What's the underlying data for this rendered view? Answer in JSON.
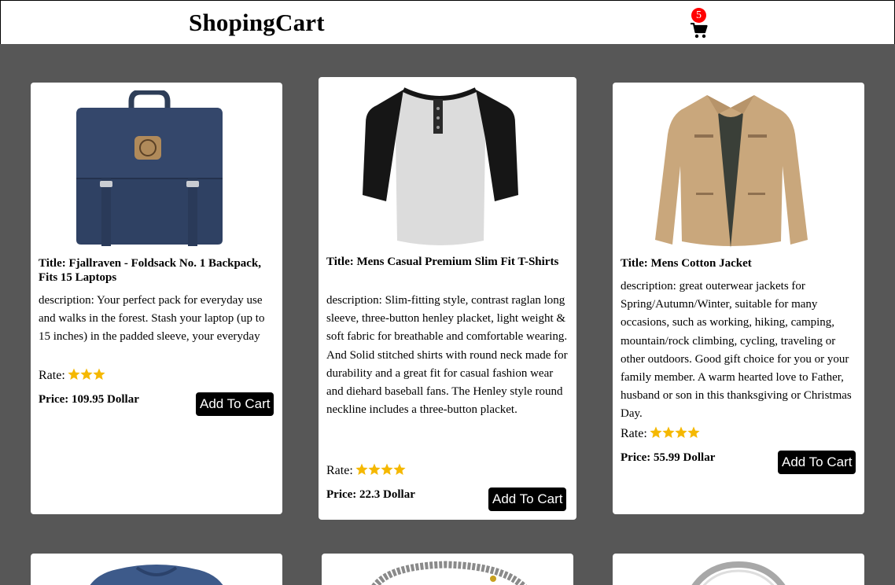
{
  "header": {
    "logo": "ShopingCart",
    "cart_count": "5"
  },
  "rate_label": "Rate:",
  "button_label": "Add To Cart",
  "products": [
    {
      "title": "Title: Fjallraven - Foldsack No. 1 Backpack, Fits 15 Laptops",
      "description": "description: Your perfect pack for everyday use and walks in the forest. Stash your laptop (up to 15 inches) in the padded sleeve, your everyday",
      "rating": 3,
      "price": "Price: 109.95 Dollar"
    },
    {
      "title": "Title: Mens Casual Premium Slim Fit T-Shirts",
      "description": "description: Slim-fitting style, contrast raglan long sleeve, three-button henley placket, light weight & soft fabric for breathable and comfortable wearing. And Solid stitched shirts with round neck made for durability and a great fit for casual fashion wear and diehard baseball fans. The Henley style round neckline includes a three-button placket.",
      "rating": 4,
      "price": "Price: 22.3 Dollar"
    },
    {
      "title": "Title: Mens Cotton Jacket",
      "description": "description: great outerwear jackets for Spring/Autumn/Winter, suitable for many occasions, such as working, hiking, camping, mountain/rock climbing, cycling, traveling or other outdoors. Good gift choice for you or your family member. A warm hearted love to Father, husband or son in this thanksgiving or Christmas Day.",
      "rating": 4,
      "price": "Price: 55.99 Dollar"
    }
  ],
  "star_color": "#f5b800"
}
